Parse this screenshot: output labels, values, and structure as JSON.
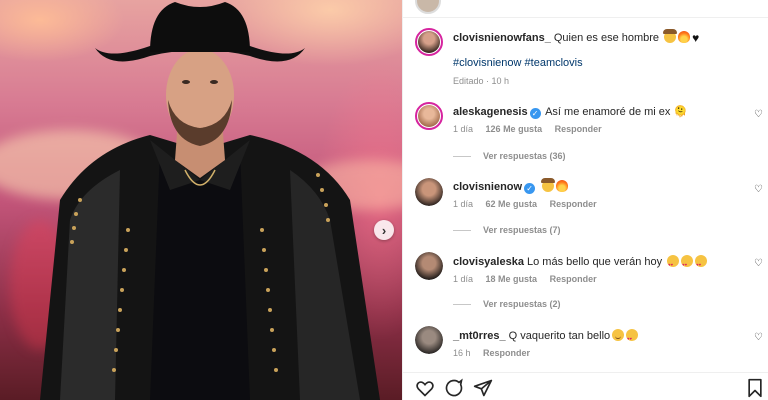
{
  "post": {
    "author": "clovisnienowfans_",
    "caption": "Quien es ese hombre",
    "hashtags": "#clovisnienow #teamclovis",
    "edited": "Editado · 10 h"
  },
  "comments": [
    {
      "username": "aleskagenesis",
      "verified": true,
      "text": "Así me enamoré de mi ex 🫠",
      "time": "1 día",
      "likes": "126 Me gusta",
      "reply": "Responder",
      "view_replies": "Ver respuestas (36)"
    },
    {
      "username": "clovisnienow",
      "verified": true,
      "text": "",
      "time": "1 día",
      "likes": "62 Me gusta",
      "reply": "Responder",
      "view_replies": "Ver respuestas (7)"
    },
    {
      "username": "clovisyaleska",
      "verified": false,
      "text": "Lo más bello que verán hoy",
      "time": "1 día",
      "likes": "18 Me gusta",
      "reply": "Responder",
      "view_replies": "Ver respuestas (2)"
    },
    {
      "username": "_mt0rres_",
      "verified": false,
      "text": "Q vaquerito tan bello",
      "time": "16 h",
      "likes": "",
      "reply": "Responder",
      "view_replies": ""
    }
  ],
  "icons": {
    "carousel": "chevron-right-icon",
    "like": "heart-icon",
    "comment": "comment-icon",
    "share": "paper-plane-icon",
    "save": "bookmark-icon"
  },
  "colors": {
    "link": "#00376b",
    "verified": "#3897f0",
    "muted": "#8e8e8e"
  }
}
